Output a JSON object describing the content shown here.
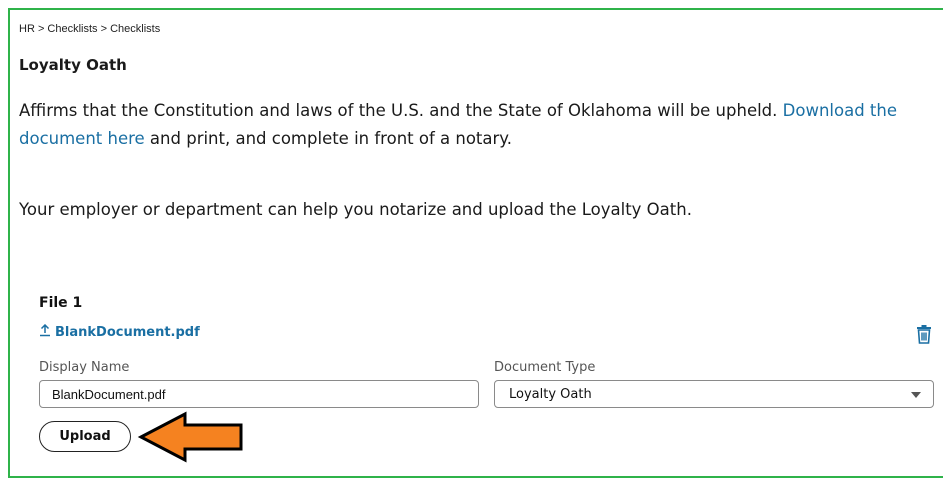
{
  "breadcrumb": "HR > Checklists > Checklists",
  "page_title": "Loyalty Oath",
  "description": {
    "text_before": "Affirms that the Constitution and laws of the U.S. and the State of Oklahoma will be upheld. ",
    "link_text": "Download the document here",
    "text_after": " and print, and complete in front of a notary."
  },
  "help_text": "Your employer or department can help you notarize and upload the Loyalty Oath.",
  "file": {
    "heading": "File 1",
    "filename": "BlankDocument.pdf",
    "upload_icon": "upload-arrow-icon",
    "delete_icon": "trash-icon",
    "display_name_label": "Display Name",
    "display_name_value": "BlankDocument.pdf",
    "document_type_label": "Document Type",
    "document_type_value": "Loyalty Oath"
  },
  "upload_button": "Upload",
  "colors": {
    "frame_border": "#2fb34a",
    "link": "#1a6fa3",
    "annotation_fill": "#f58220"
  }
}
